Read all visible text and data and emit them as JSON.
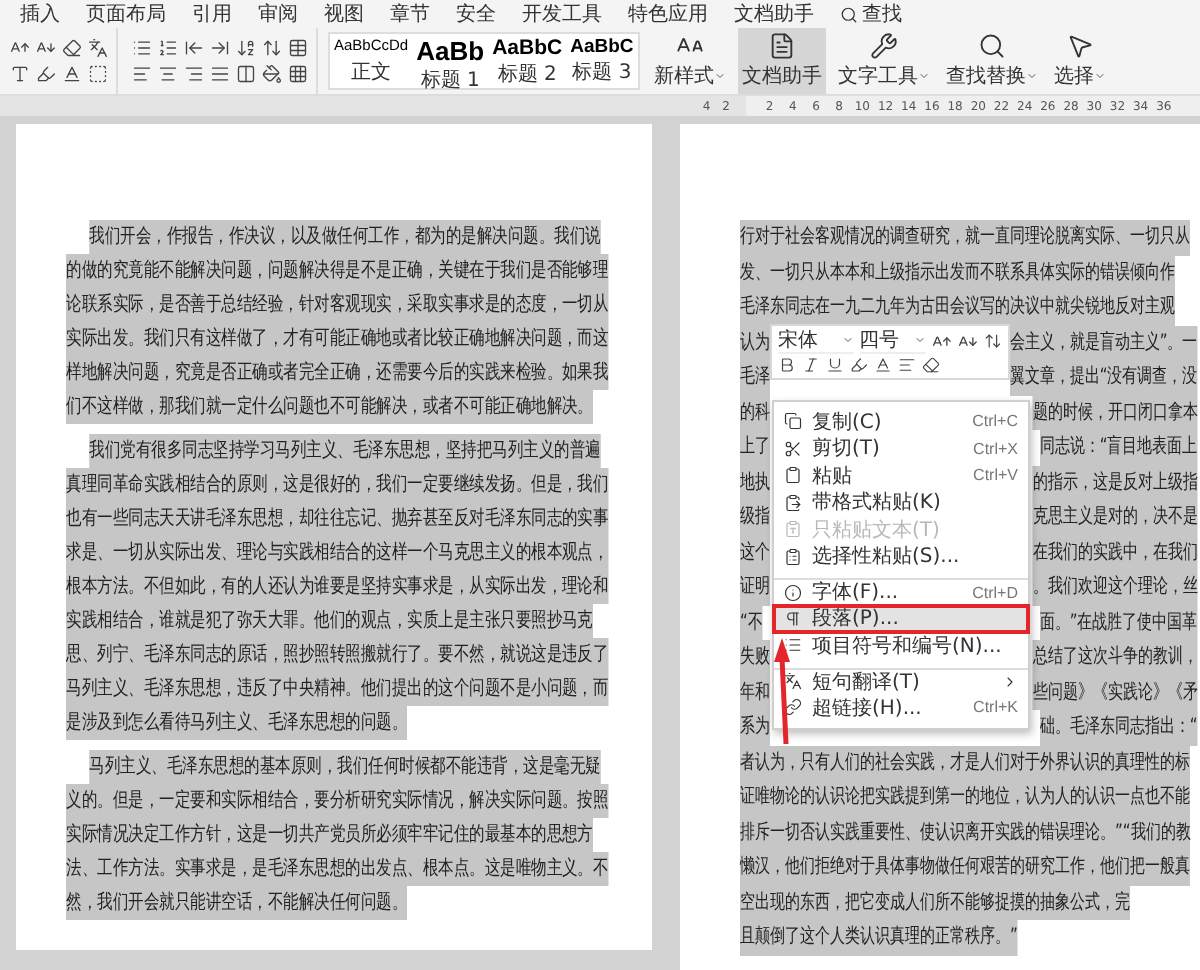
{
  "menu_tabs": [
    "插入",
    "页面布局",
    "引用",
    "审阅",
    "视图",
    "章节",
    "安全",
    "开发工具",
    "特色应用",
    "文档助手"
  ],
  "search_tab": {
    "label": "查找"
  },
  "style_gallery": [
    {
      "sample": "AaBbCcDd",
      "label": "正文",
      "kind": "body"
    },
    {
      "sample": "AaBb",
      "label": "标题 1",
      "kind": "heading1"
    },
    {
      "sample": "AaBbC",
      "label": "标题 2",
      "kind": "heading2"
    },
    {
      "sample": "AaBbC",
      "label": "标题 3",
      "kind": "heading3"
    }
  ],
  "ribbon_buttons": [
    {
      "label": "新样式",
      "kind": "styles",
      "dropdown": true,
      "selected": false
    },
    {
      "label": "文档助手",
      "kind": "assistant",
      "dropdown": false,
      "selected": true
    },
    {
      "label": "文字工具",
      "kind": "tools",
      "dropdown": true,
      "selected": false
    },
    {
      "label": "查找替换",
      "kind": "find",
      "dropdown": true,
      "selected": false
    },
    {
      "label": "选择",
      "kind": "select",
      "dropdown": true,
      "selected": false
    }
  ],
  "ruler": {
    "left_numbers": [
      "4",
      "2"
    ],
    "numbers": [
      "2",
      "4",
      "6",
      "8",
      "10",
      "12",
      "14",
      "16",
      "18",
      "20",
      "22",
      "24",
      "26",
      "28",
      "30",
      "32",
      "34",
      "36"
    ]
  },
  "left_page": {
    "paragraphs": [
      "我们开会，作报告，作决议，以及做任何工作，都为的是解决问题。我们说的做的究竟能不能解决问题，问题解决得是不是正确，关键在于我们是否能够理论联系实际，是否善于总结经验，针对客观现实，采取实事求是的态度，一切从实际出发。我们只有这样做了，才有可能正确地或者比较正确地解决问题，而这样地解决问题，究竟是否正确或者完全正确，还需要今后的实践来检验。如果我们不这样做，那我们就一定什么问题也不可能解决，或者不可能正确地解决。",
      "我们党有很多同志坚持学习马列主义、毛泽东思想，坚持把马列主义的普遍真理同革命实践相结合的原则，这是很好的，我们一定要继续发扬。但是，我们也有一些同志天天讲毛泽东思想，却往往忘记、抛弃甚至反对毛泽东同志的实事求是、一切从实际出发、理论与实践相结合的这样一个马克思主义的根本观点，根本方法。不但如此，有的人还认为谁要是坚持实事求是，从实际出发，理论和实践相结合，谁就是犯了弥天大罪。他们的观点，实质上是主张只要照抄马克思、列宁、毛泽东同志的原话，照抄照转照搬就行了。要不然，就说这是违反了马列主义、毛泽东思想，违反了中央精神。他们提出的这个问题不是小问题，而是涉及到怎么看待马列主义、毛泽东思想的问题。",
      "马列主义、毛泽东思想的基本原则，我们任何时候都不能违背，这是毫无疑义的。但是，一定要和实际相结合，要分析研究实际情况，解决实际问题。按照实际情况决定工作方针，这是一切共产党员所必须牢牢记住的最基本的思想方法、工作方法。实事求是，是毛泽东思想的出发点、根本点。这是唯物主义。不然，我们开会就只能讲空话，不能解决任何问题。"
    ]
  },
  "right_page": {
    "lines": [
      {
        "text": "行对于社会客观情况的调查研究，就一直同理论脱离实际、一切只从"
      },
      {
        "text": "发、一切只从本本和上级指示出发而不联系具体实际的错误倾向作"
      },
      {
        "text": "毛泽东同志在一九二九年为古田会议写的决议中就尖锐地反对主观"
      },
      {
        "left": "认为",
        "right": "会主义，就是盲动主义”。一"
      },
      {
        "left": "毛泽",
        "right": "翼文章，提出“没有调查，没"
      },
      {
        "left": "的科",
        "right": "题的时候，开口闭口拿本"
      },
      {
        "left": "上了",
        "right": "同志说：“盲目地表面上"
      },
      {
        "left": "地执",
        "right": "的指示，这是反对上级指"
      },
      {
        "left": "级指",
        "right": "克思主义是对的，决不是"
      },
      {
        "left": "这个",
        "right": "在我们的实践中，在我们"
      },
      {
        "left": "证明",
        "right": "。我们欢迎这个理论，丝"
      },
      {
        "left": "“不",
        "right": "面。”在战胜了使中国革"
      },
      {
        "left": "失败",
        "right": "总结了这次斗争的教训，"
      },
      {
        "left": "年和",
        "right": "些问题》《实践论》《矛"
      },
      {
        "left": "系为",
        "right": "础。毛泽东同志指出：“"
      },
      {
        "text": "者认为，只有人们的社会实践，才是人们对于外界认识的真理性的标"
      },
      {
        "text": "证唯物论的认识论把实践提到第一的地位，认为人的认识一点也不能"
      },
      {
        "text": "排斥一切否认实践重要性、使认识离开实践的错误理论。”“我们的教"
      },
      {
        "text": "懒汉，他们拒绝对于具体事物做任何艰苦的研究工作，他们把一般真"
      },
      {
        "text": "空出现的东西，把它变成人们所不能够捉摸的抽象公式，完"
      },
      {
        "text": "且颠倒了这个人类认识真理的正常秩序。”"
      }
    ]
  },
  "mini_toolbar": {
    "font": "宋体",
    "size": "四号"
  },
  "context_menu": [
    {
      "label": "复制(C)",
      "shortcut": "Ctrl+C",
      "kind": "copy",
      "disabled": false,
      "selected": false,
      "separator_before": false
    },
    {
      "label": "剪切(T)",
      "shortcut": "Ctrl+X",
      "kind": "cut",
      "disabled": false,
      "selected": false,
      "separator_before": false
    },
    {
      "label": "粘贴",
      "shortcut": "Ctrl+V",
      "kind": "paste",
      "disabled": false,
      "selected": false,
      "separator_before": false
    },
    {
      "label": "带格式粘贴(K)",
      "kind": "paste-format",
      "disabled": false,
      "selected": false,
      "separator_before": false
    },
    {
      "label": "只粘贴文本(T)",
      "kind": "paste-text",
      "disabled": true,
      "selected": false,
      "separator_before": false
    },
    {
      "label": "选择性粘贴(S)...",
      "kind": "paste-special",
      "disabled": false,
      "selected": false,
      "separator_before": false
    },
    {
      "label": "字体(F)...",
      "shortcut": "Ctrl+D",
      "kind": "font",
      "disabled": false,
      "selected": false,
      "separator_before": true
    },
    {
      "label": "段落(P)...",
      "kind": "paragraph",
      "disabled": false,
      "selected": true,
      "separator_before": false
    },
    {
      "label": "项目符号和编号(N)...",
      "kind": "bullets",
      "disabled": false,
      "selected": false,
      "separator_before": false
    },
    {
      "label": "短句翻译(T)",
      "kind": "translate",
      "submenu": true,
      "disabled": false,
      "selected": false,
      "separator_before": true
    },
    {
      "label": "超链接(H)...",
      "shortcut": "Ctrl+K",
      "kind": "link",
      "disabled": false,
      "selected": false,
      "separator_before": false
    }
  ]
}
